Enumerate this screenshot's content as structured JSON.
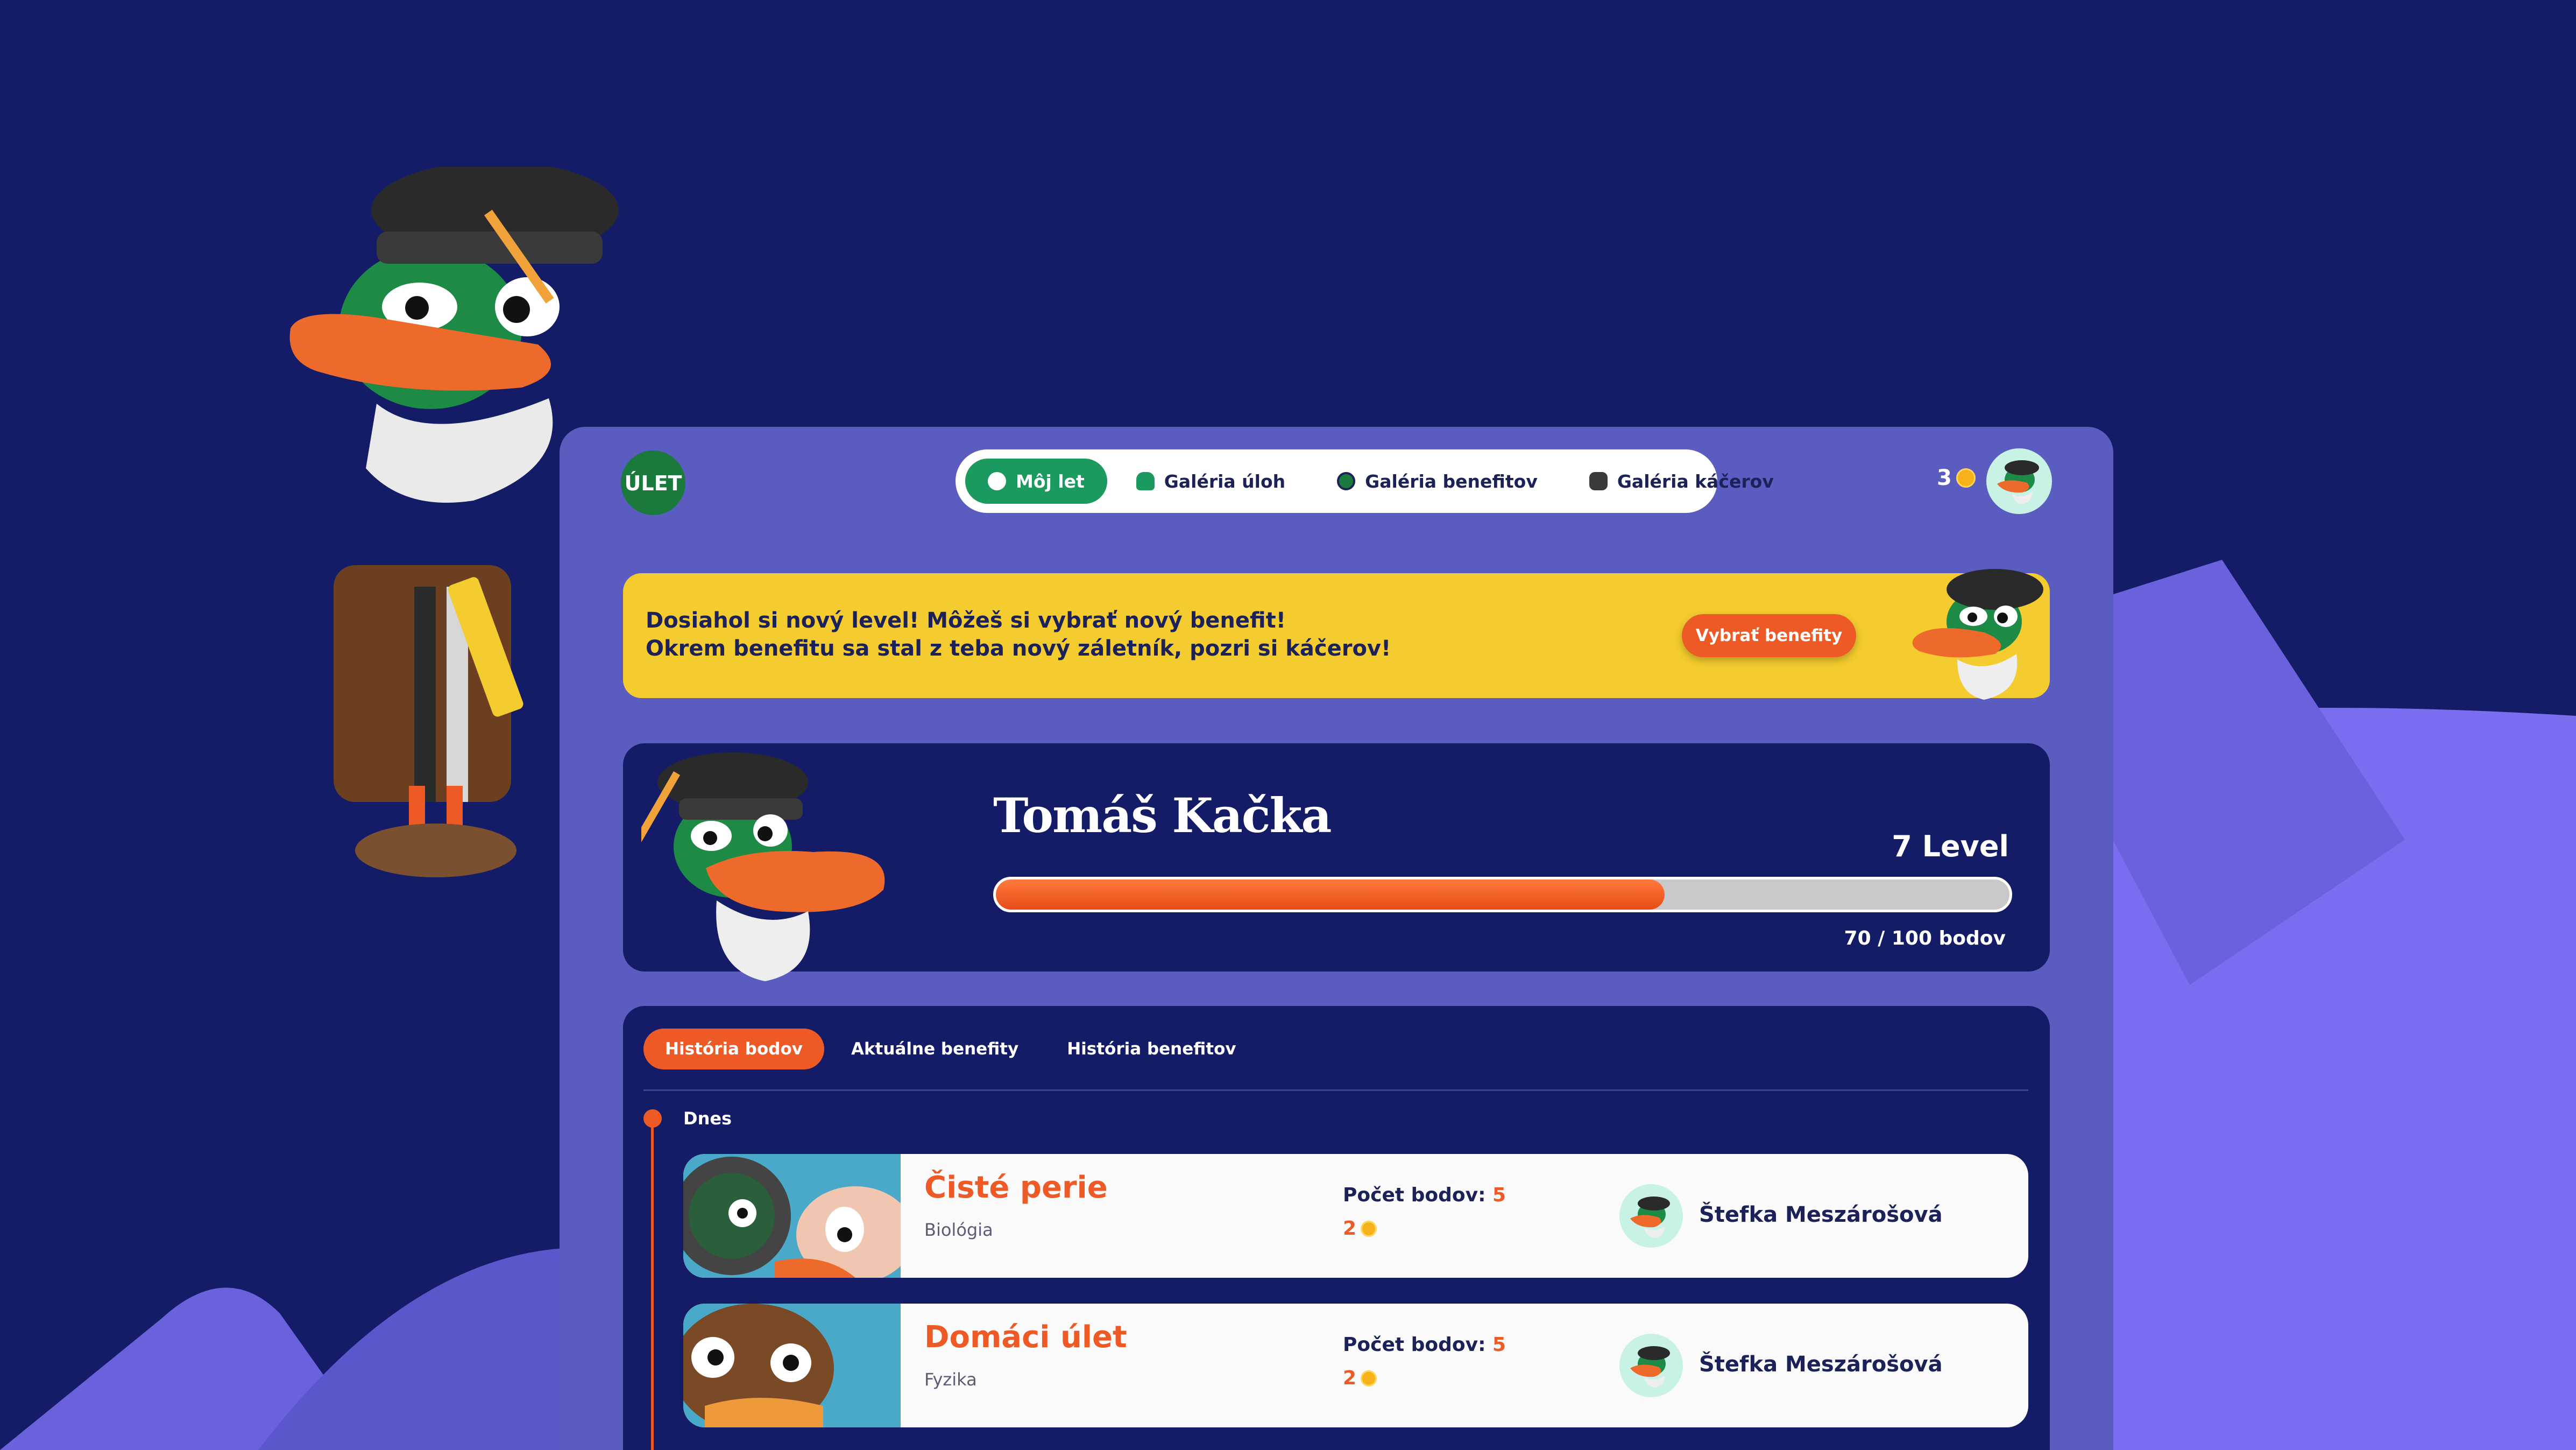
{
  "nav": {
    "logo_text": "ÚLET",
    "items": [
      {
        "label": "Môj let",
        "active": true,
        "icon": "duck-head-icon"
      },
      {
        "label": "Galéria úloh",
        "active": false,
        "icon": "bell-icon"
      },
      {
        "label": "Galéria benefitov",
        "active": false,
        "icon": "badge-icon"
      },
      {
        "label": "Galéria káčerov",
        "active": false,
        "icon": "duck-hat-icon"
      }
    ],
    "coins": "3"
  },
  "banner": {
    "line1": "Dosiahol si nový level! Môžeš si vybrať nový benefit!",
    "line2": "Okrem benefitu sa stal z teba nový záletník, pozri si káčerov!",
    "button": "Vybrať benefity"
  },
  "profile": {
    "name": "Tomáš Kačka",
    "level": "7 Level",
    "points_text": "70 / 100 bodov",
    "progress": 0.66
  },
  "tabs": [
    "História bodov",
    "Aktuálne benefity",
    "História benefitov"
  ],
  "history": {
    "day": "Dnes",
    "items": [
      {
        "title": "Čisté perie",
        "subject": "Biológia",
        "points_label": "Počet bodov:",
        "points": "5",
        "coins": "2",
        "teacher": "Štefka Meszárošová"
      },
      {
        "title": "Domáci úlet",
        "subject": "Fyzika",
        "points_label": "Počet bodov:",
        "points": "5",
        "coins": "2",
        "teacher": "Štefka Meszárošová"
      }
    ]
  },
  "colors": {
    "background": "#141c68",
    "app": "#5a5cbf",
    "accent": "#ee5a25",
    "green": "#1a9a5f",
    "banner": "#f4cc2f"
  }
}
